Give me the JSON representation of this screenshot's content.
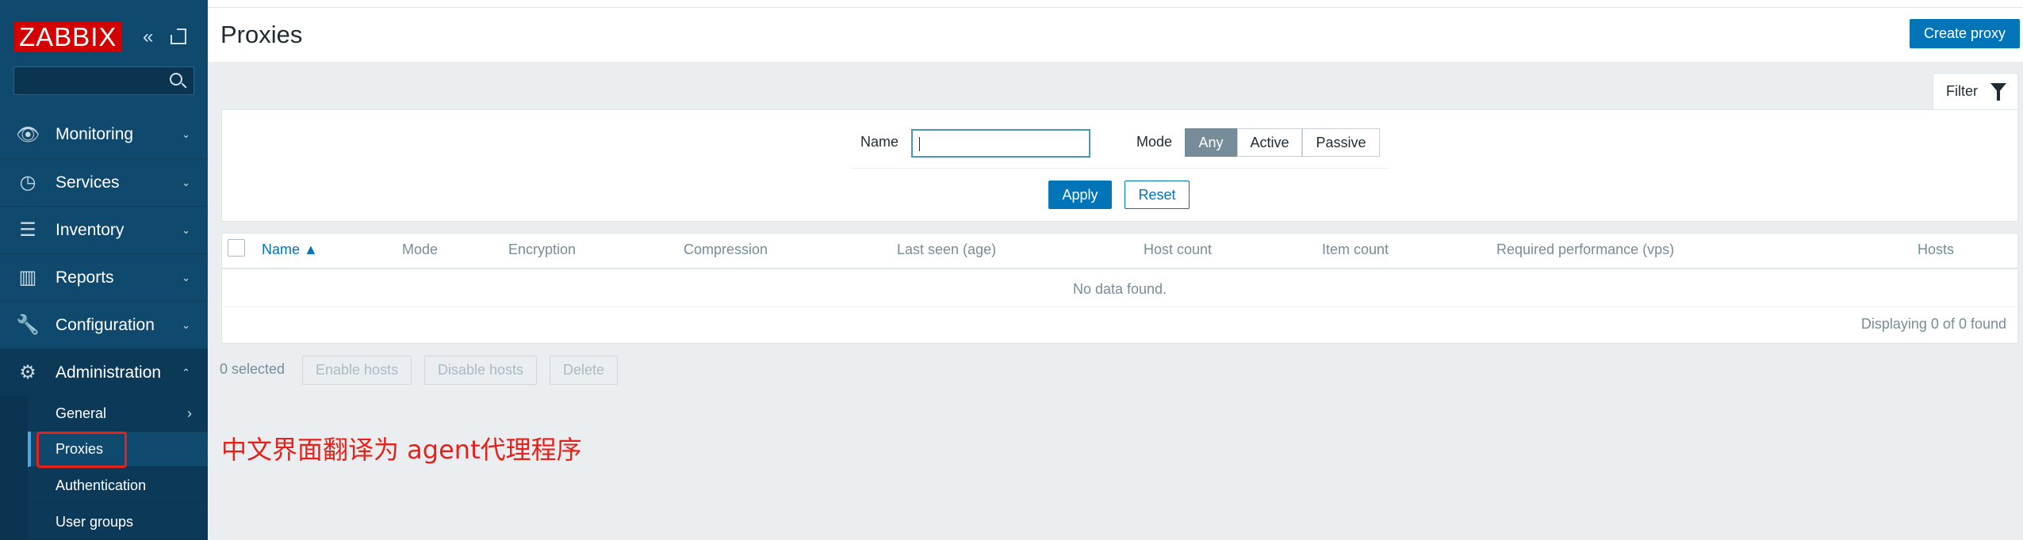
{
  "brand": {
    "logo_text": "ZABBIX",
    "primary": "#0275b8",
    "sidebar_bg": "#0f4a6e",
    "logo_red": "#d40000",
    "annotation_red": "#e8201a"
  },
  "sidebar": {
    "search_placeholder": "",
    "menu": [
      {
        "label": "Monitoring",
        "icon": "eye-icon",
        "arrow": "⌄"
      },
      {
        "label": "Services",
        "icon": "clock-icon",
        "arrow": "⌄"
      },
      {
        "label": "Inventory",
        "icon": "list-icon",
        "arrow": "⌄"
      },
      {
        "label": "Reports",
        "icon": "bar-chart-icon",
        "arrow": "⌄"
      },
      {
        "label": "Configuration",
        "icon": "wrench-icon",
        "arrow": "⌄"
      },
      {
        "label": "Administration",
        "icon": "gear-icon",
        "arrow": "⌃"
      }
    ],
    "submenu": [
      {
        "label": "General",
        "arrow": "›"
      },
      {
        "label": "Proxies"
      },
      {
        "label": "Authentication"
      },
      {
        "label": "User groups"
      }
    ]
  },
  "header": {
    "title": "Proxies",
    "create_label": "Create proxy"
  },
  "filter": {
    "tab_label": "Filter",
    "name_label": "Name",
    "name_value": "",
    "mode_label": "Mode",
    "modes": [
      "Any",
      "Active",
      "Passive"
    ],
    "selected_mode": "Any",
    "apply_label": "Apply",
    "reset_label": "Reset"
  },
  "table": {
    "columns": [
      "Name ▲",
      "Mode",
      "Encryption",
      "Compression",
      "Last seen (age)",
      "Host count",
      "Item count",
      "Required performance (vps)",
      "Hosts"
    ],
    "empty_text": "No data found.",
    "displaying": "Displaying 0 of 0 found"
  },
  "actions": {
    "selected": "0 selected",
    "enable": "Enable hosts",
    "disable": "Disable hosts",
    "delete": "Delete"
  },
  "annotation": "中文界面翻译为 agent代理程序"
}
